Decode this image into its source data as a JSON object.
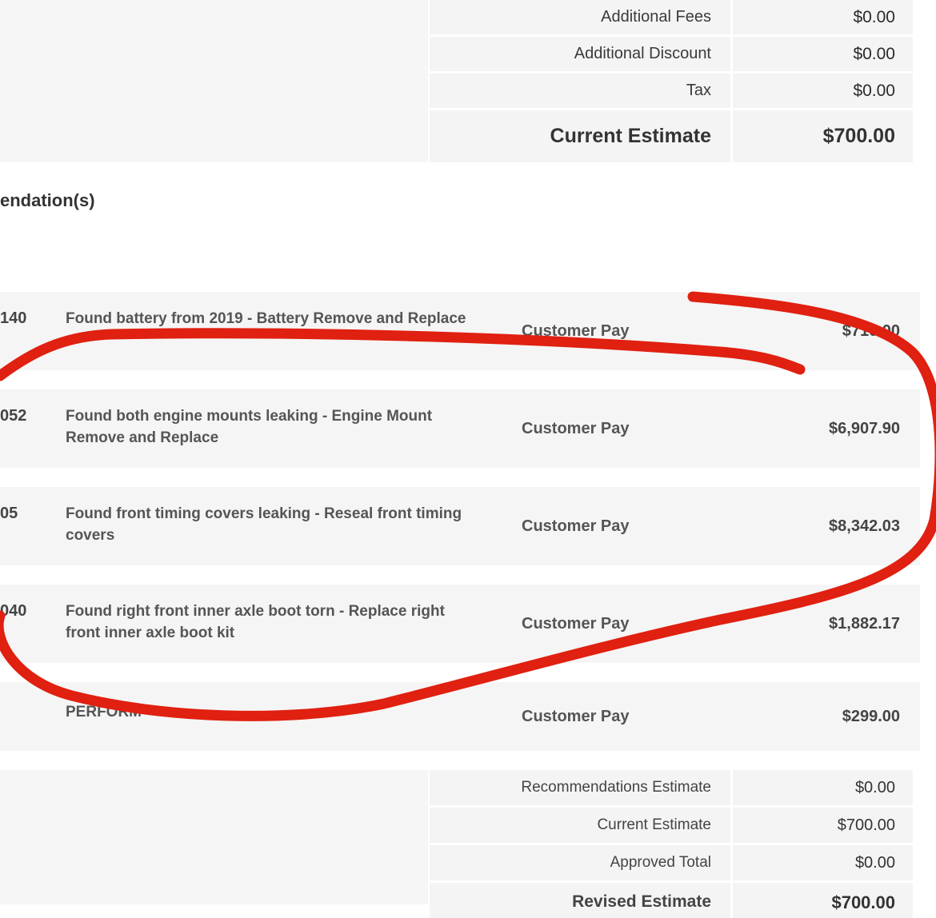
{
  "top_summary": [
    {
      "label": "Additional Fees",
      "value": "$0.00"
    },
    {
      "label": "Additional Discount",
      "value": "$0.00"
    },
    {
      "label": "Tax",
      "value": "$0.00"
    },
    {
      "label": "Current Estimate",
      "value": "$700.00"
    }
  ],
  "section_heading": "endation(s)",
  "recommendations": [
    {
      "code": "140",
      "description": "Found battery from 2019 - Battery Remove and Replace",
      "pay_type": "Customer Pay",
      "amount": "$710.00"
    },
    {
      "code": "052",
      "description": "Found both engine mounts leaking - Engine Mount Remove and Replace",
      "pay_type": "Customer Pay",
      "amount": "$6,907.90"
    },
    {
      "code": "05",
      "description": "Found front timing covers leaking - Reseal front timing covers",
      "pay_type": "Customer Pay",
      "amount": "$8,342.03"
    },
    {
      "code": "040",
      "description": "Found right front inner axle boot torn - Replace right front inner axle boot kit",
      "pay_type": "Customer Pay",
      "amount": "$1,882.17"
    },
    {
      "code": "",
      "description": "PERFORM",
      "pay_type": "Customer Pay",
      "amount": "$299.00"
    }
  ],
  "bottom_summary": [
    {
      "label": "Recommendations Estimate",
      "value": "$0.00"
    },
    {
      "label": "Current Estimate",
      "value": "$700.00"
    },
    {
      "label": "Approved Total",
      "value": "$0.00"
    },
    {
      "label": "Revised Estimate",
      "value": "$700.00"
    }
  ],
  "annotation_color": "#e02010"
}
